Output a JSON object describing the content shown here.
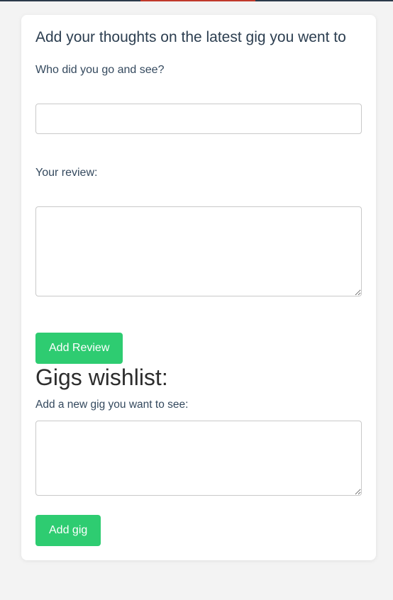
{
  "review_form": {
    "title": "Add your thoughts on the latest gig you went to",
    "artist_label": "Who did you go and see?",
    "artist_value": "",
    "review_label": "Your review:",
    "review_value": "",
    "submit_label": "Add Review"
  },
  "wishlist": {
    "title": "Gigs wishlist:",
    "new_gig_label": "Add a new gig you want to see:",
    "new_gig_value": "",
    "submit_label": "Add gig"
  },
  "colors": {
    "accent_green": "#2ecc71",
    "page_background": "#f3f3f3",
    "text_dark": "#2c3e50"
  }
}
